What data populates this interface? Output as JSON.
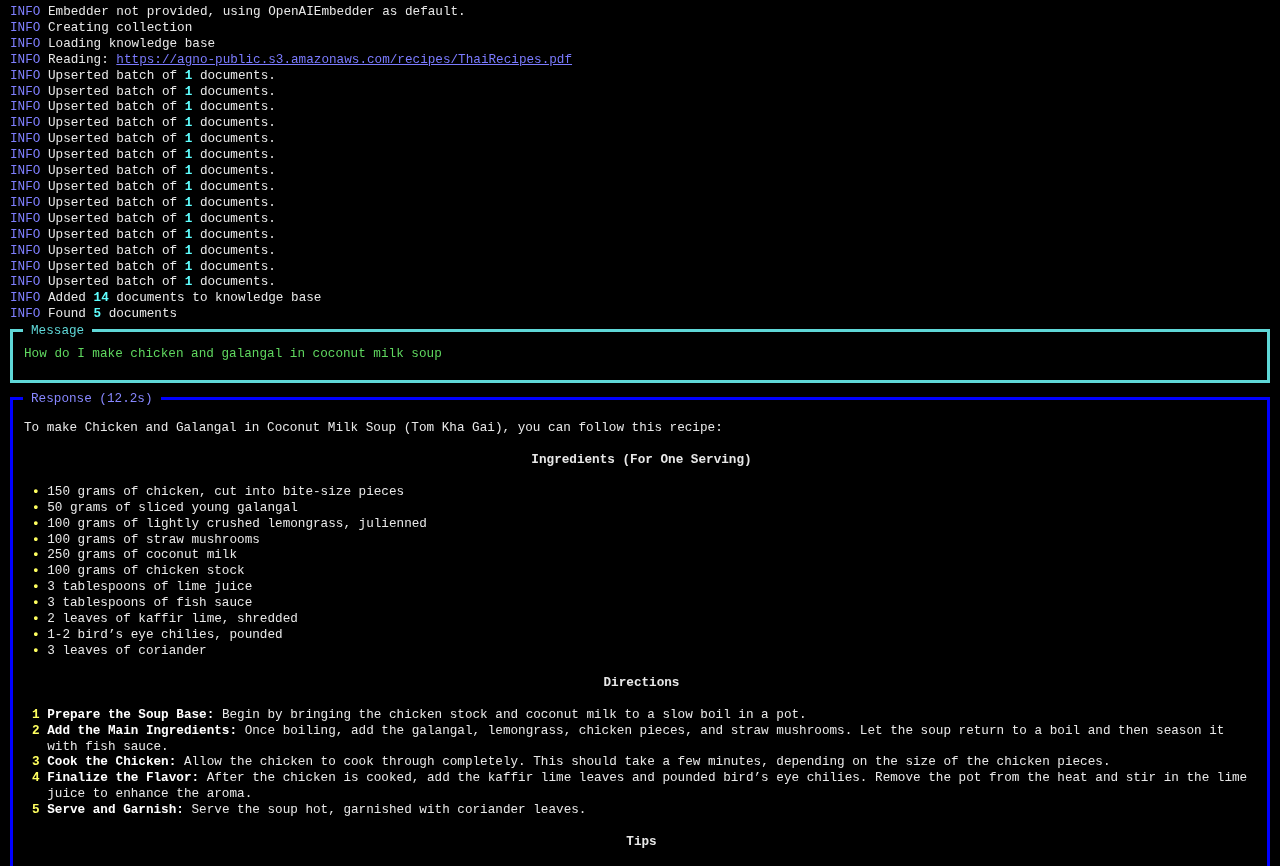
{
  "log": [
    {
      "kind": "info",
      "level": "INFO",
      "text": "Embedder not provided, using OpenAIEmbedder as default."
    },
    {
      "kind": "info",
      "level": "INFO",
      "text": "Creating collection"
    },
    {
      "kind": "info",
      "level": "INFO",
      "text": "Loading knowledge base"
    },
    {
      "kind": "link",
      "level": "INFO",
      "text": "Reading:",
      "url": "https://agno-public.s3.amazonaws.com/recipes/ThaiRecipes.pdf"
    },
    {
      "kind": "info",
      "level": "INFO",
      "text": "Upserted batch of **1** documents."
    },
    {
      "kind": "info",
      "level": "INFO",
      "text": "Upserted batch of **1** documents."
    },
    {
      "kind": "info",
      "level": "INFO",
      "text": "Upserted batch of **1** documents."
    },
    {
      "kind": "info",
      "level": "INFO",
      "text": "Upserted batch of **1** documents."
    },
    {
      "kind": "info",
      "level": "INFO",
      "text": "Upserted batch of **1** documents."
    },
    {
      "kind": "info",
      "level": "INFO",
      "text": "Upserted batch of **1** documents."
    },
    {
      "kind": "info",
      "level": "INFO",
      "text": "Upserted batch of **1** documents."
    },
    {
      "kind": "info",
      "level": "INFO",
      "text": "Upserted batch of **1** documents."
    },
    {
      "kind": "info",
      "level": "INFO",
      "text": "Upserted batch of **1** documents."
    },
    {
      "kind": "info",
      "level": "INFO",
      "text": "Upserted batch of **1** documents."
    },
    {
      "kind": "info",
      "level": "INFO",
      "text": "Upserted batch of **1** documents."
    },
    {
      "kind": "info",
      "level": "INFO",
      "text": "Upserted batch of **1** documents."
    },
    {
      "kind": "info",
      "level": "INFO",
      "text": "Upserted batch of **1** documents."
    },
    {
      "kind": "info",
      "level": "INFO",
      "text": "Upserted batch of **1** documents."
    },
    {
      "kind": "info",
      "level": "INFO",
      "text": "Added **14** documents to knowledge base"
    },
    {
      "kind": "info",
      "level": "INFO",
      "text": "Found **5** documents"
    }
  ],
  "message": {
    "title": "Message",
    "text": "How do I make chicken and galangal in coconut milk soup"
  },
  "response": {
    "title": "Response (12.2s)",
    "blocks": [
      {
        "kind": "paragraph",
        "text": "To make Chicken and Galangal in Coconut Milk Soup (Tom Kha Gai), you can follow this recipe:"
      },
      {
        "kind": "heading",
        "text": "Ingredients (For One Serving)"
      },
      {
        "kind": "list",
        "items": [
          {
            "marker": "•",
            "text": "150 grams of chicken, cut into bite-size pieces"
          },
          {
            "marker": "•",
            "text": "50 grams of sliced young galangal"
          },
          {
            "marker": "•",
            "text": "100 grams of lightly crushed lemongrass, julienned"
          },
          {
            "marker": "•",
            "text": "100 grams of straw mushrooms"
          },
          {
            "marker": "•",
            "text": "250 grams of coconut milk"
          },
          {
            "marker": "•",
            "text": "100 grams of chicken stock"
          },
          {
            "marker": "•",
            "text": "3 tablespoons of lime juice"
          },
          {
            "marker": "•",
            "text": "3 tablespoons of fish sauce"
          },
          {
            "marker": "•",
            "text": "2 leaves of kaffir lime, shredded"
          },
          {
            "marker": "•",
            "text": "1-2 bird’s eye chilies, pounded"
          },
          {
            "marker": "•",
            "text": "3 leaves of coriander"
          }
        ]
      },
      {
        "kind": "heading",
        "text": "Directions"
      },
      {
        "kind": "list",
        "items": [
          {
            "marker": "1",
            "text": "**Prepare the Soup Base:** Begin by bringing the chicken stock and coconut milk to a slow boil in a pot."
          },
          {
            "marker": "2",
            "text": "**Add the Main Ingredients:** Once boiling, add the galangal, lemongrass, chicken pieces, and straw mushrooms. Let the soup return to a boil and then season it with fish sauce."
          },
          {
            "marker": "3",
            "text": "**Cook the Chicken:** Allow the chicken to cook through completely. This should take a few minutes, depending on the size of the chicken pieces."
          },
          {
            "marker": "4",
            "text": "**Finalize the Flavor:** After the chicken is cooked, add the kaffir lime leaves and pounded bird’s eye chilies. Remove the pot from the heat and stir in the lime juice to enhance the aroma."
          },
          {
            "marker": "5",
            "text": "**Serve and Garnish:** Serve the soup hot, garnished with coriander leaves."
          }
        ]
      },
      {
        "kind": "heading",
        "text": "Tips"
      }
    ]
  }
}
